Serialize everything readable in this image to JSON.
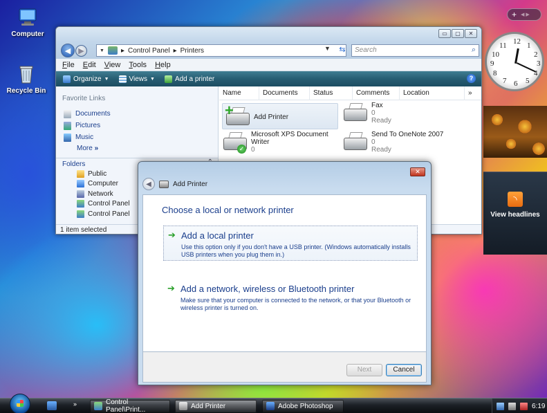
{
  "desktop": {
    "icons": [
      {
        "label": "Computer"
      },
      {
        "label": "Recycle Bin"
      }
    ]
  },
  "sidebar": {
    "add_button": "+",
    "feed_label": "View headlines",
    "clock_numbers": [
      "12",
      "1",
      "2",
      "3",
      "4",
      "5",
      "6",
      "7",
      "8",
      "9",
      "10",
      "11"
    ]
  },
  "explorer": {
    "breadcrumb": [
      "Control Panel",
      "Printers"
    ],
    "search_placeholder": "Search",
    "menu": [
      "File",
      "Edit",
      "View",
      "Tools",
      "Help"
    ],
    "toolbar": {
      "organize": "Organize",
      "views": "Views",
      "add_printer": "Add a printer"
    },
    "favorite_links_title": "Favorite Links",
    "favorite_links": [
      "Documents",
      "Pictures",
      "Music"
    ],
    "more": "More",
    "folders_title": "Folders",
    "folders": [
      "Public",
      "Computer",
      "Network",
      "Control Panel",
      "Control Panel"
    ],
    "columns": [
      "Name",
      "Documents",
      "Status",
      "Comments",
      "Location"
    ],
    "printers": [
      {
        "name": "Add Printer",
        "lines": []
      },
      {
        "name": "Fax",
        "lines": [
          "0",
          "Ready"
        ]
      },
      {
        "name": "Microsoft XPS Document Writer",
        "lines": [
          "0"
        ]
      },
      {
        "name": "Send To OneNote 2007",
        "lines": [
          "0",
          "Ready"
        ]
      }
    ],
    "status": "1 item selected"
  },
  "dialog": {
    "title": "Add Printer",
    "heading": "Choose a local or network printer",
    "options": [
      {
        "title": "Add a local printer",
        "description": "Use this option only if you don't have a USB printer. (Windows automatically installs USB printers when you plug them in.)"
      },
      {
        "title": "Add a network, wireless or Bluetooth printer",
        "description": "Make sure that your computer is connected to the network, or that your Bluetooth or wireless printer is turned on."
      }
    ],
    "next_label": "Next",
    "cancel_label": "Cancel"
  },
  "taskbar": {
    "tasks": [
      "Control Panel\\Print...",
      "Add Printer",
      "Adobe Photoshop"
    ],
    "time": "6:19"
  }
}
